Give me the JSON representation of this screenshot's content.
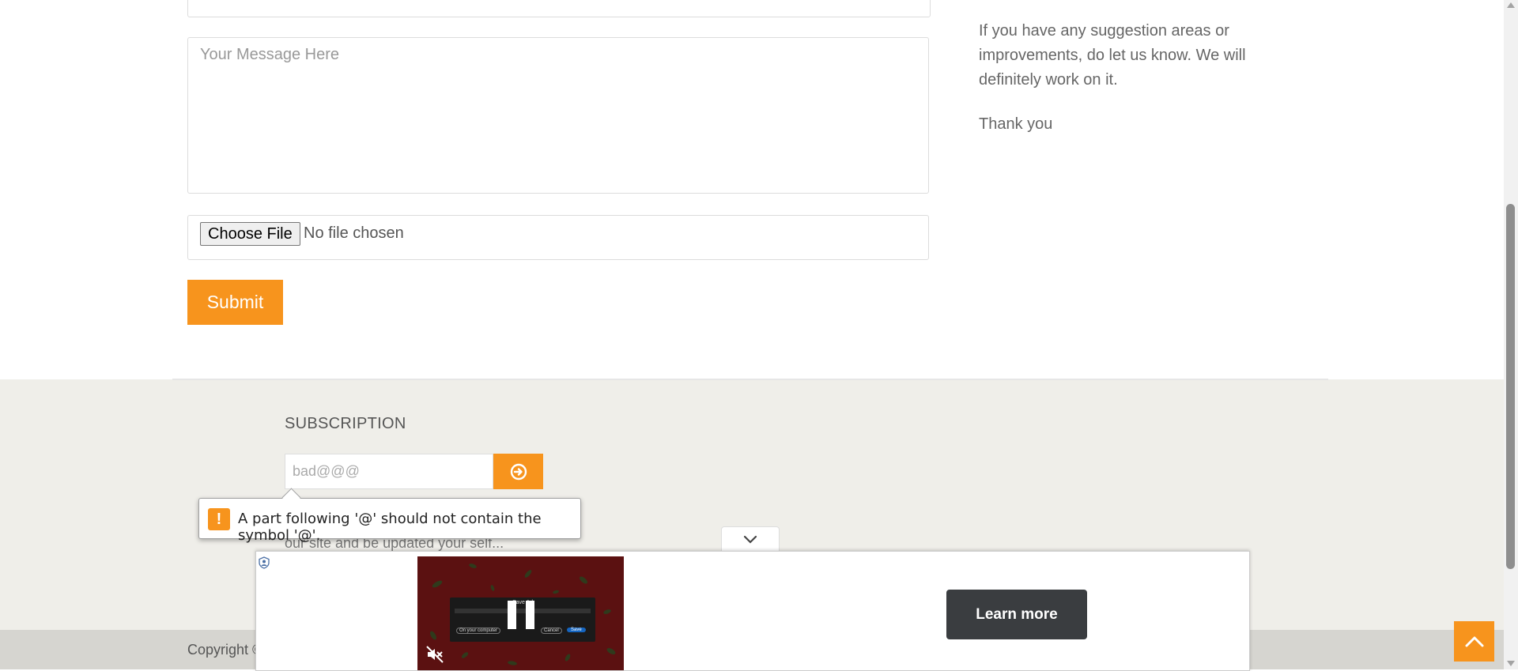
{
  "form": {
    "message_placeholder": "Your Message Here",
    "file_button_label": "Choose File",
    "file_status": "No file chosen",
    "submit_label": "Submit"
  },
  "sidebar": {
    "suggestion_text": "If you have any suggestion areas or improvements, do let us know. We will definitely work on it.",
    "thanks_text": "Thank you"
  },
  "subscription": {
    "title": "SUBSCRIPTION",
    "email_value": "bad@@@",
    "description": "our site and be updated your self...",
    "validation_message": "A part following '@' should not contain the symbol '@'."
  },
  "footer": {
    "copyright": "Copyright ©"
  },
  "ad": {
    "video_title": "Save Ad",
    "chip_computer": "On your computer",
    "chip_cancel": "Cancel",
    "chip_save": "Save",
    "learn_more_label": "Learn more"
  },
  "colors": {
    "accent": "#f7941d",
    "footer_bg": "#efeee9",
    "copyright_bg": "#d6d5d0",
    "ad_video_bg": "#5b1111"
  },
  "icons": {
    "subscribe": "arrow-circle-right-icon",
    "warning": "exclamation-icon",
    "collapse": "chevron-down-icon",
    "pause": "pause-icon",
    "mute": "muted-speaker-icon",
    "back_to_top": "chevron-up-icon"
  }
}
